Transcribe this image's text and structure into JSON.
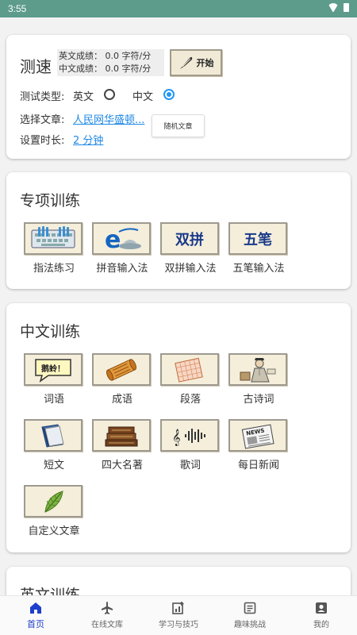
{
  "status": {
    "time": "3:55"
  },
  "speed": {
    "title": "测速",
    "en_score": "英文成绩：   0.0 字符/分",
    "cn_score": "中文成绩：   0.0 字符/分",
    "start_label": "开始",
    "type_label": "测试类型:",
    "opt_en": "英文",
    "opt_cn": "中文",
    "selected": "中文",
    "article_label": "选择文章:",
    "article_value": "人民网华盛顿...",
    "duration_label": "设置时长:",
    "duration_value": "2 分钟",
    "random_label": "随机文章"
  },
  "special": {
    "title": "专项训练",
    "items": [
      {
        "label": "指法练习",
        "icon": "keyboard-icon"
      },
      {
        "label": "拼音输入法",
        "icon": "pinyin-e-icon"
      },
      {
        "label": "双拼输入法",
        "icon": "shuangpin-icon"
      },
      {
        "label": "五笔输入法",
        "icon": "wubi-icon"
      }
    ],
    "shuangpin_text": "双拼",
    "wubi_text": "五笔"
  },
  "chinese": {
    "title": "中文训练",
    "items": [
      {
        "label": "词语",
        "icon": "speech-bubble-icon"
      },
      {
        "label": "成语",
        "icon": "scroll-icon"
      },
      {
        "label": "段落",
        "icon": "grid-paper-icon"
      },
      {
        "label": "古诗词",
        "icon": "scholar-icon"
      },
      {
        "label": "短文",
        "icon": "book-icon"
      },
      {
        "label": "四大名著",
        "icon": "books-stack-icon"
      },
      {
        "label": "歌词",
        "icon": "music-wave-icon"
      },
      {
        "label": "每日新闻",
        "icon": "newspaper-icon"
      },
      {
        "label": "自定义文章",
        "icon": "feather-icon"
      }
    ],
    "bubble_text": "鹅蛉！",
    "news_text": "NEWS"
  },
  "english": {
    "title": "英文训练"
  },
  "nav": {
    "items": [
      {
        "label": "首页",
        "icon": "home-icon",
        "active": true
      },
      {
        "label": "在线文库",
        "icon": "airplane-icon"
      },
      {
        "label": "学习与技巧",
        "icon": "chart-plus-icon"
      },
      {
        "label": "趣味挑战",
        "icon": "list-doc-icon"
      },
      {
        "label": "我的",
        "icon": "person-icon"
      }
    ]
  },
  "colors": {
    "accent": "#2196f3",
    "link": "#1e88e5",
    "status_bar": "#5d9b8b",
    "nav_active": "#1e3fcc"
  }
}
